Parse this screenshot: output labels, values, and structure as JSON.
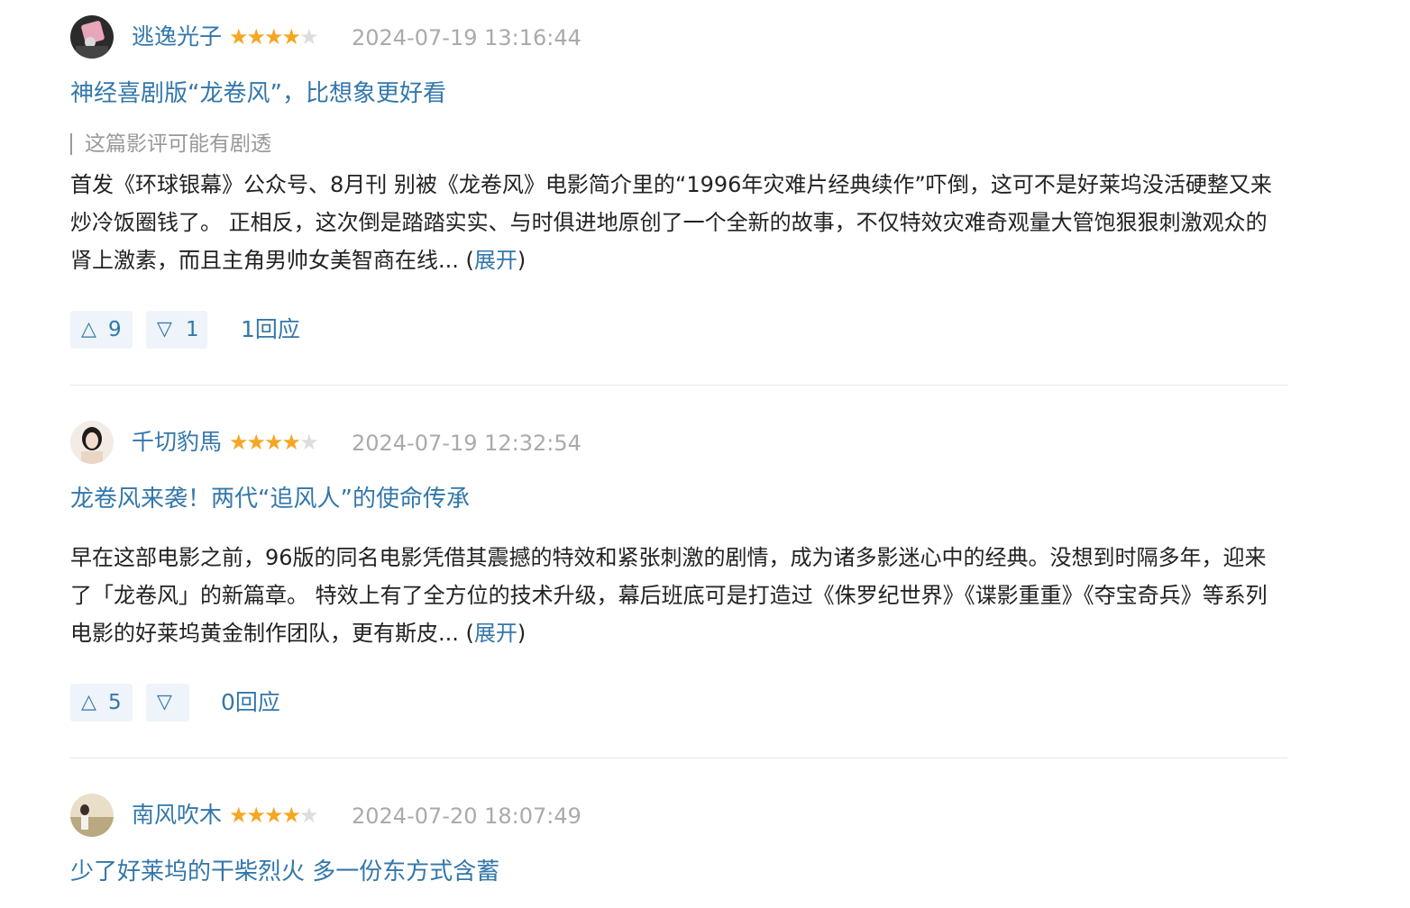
{
  "reviews": [
    {
      "author": "逃逸光子",
      "rating": 4,
      "rating_max": 5,
      "date": "2024-07-19 13:16:44",
      "title": "神经喜剧版“龙卷风”，比想象更好看",
      "spoiler": "这篇影评可能有剧透",
      "excerpt": "首发《环球银幕》公众号、8月刊 别被《龙卷风》电影简介里的“1996年灾难片经典续作”吓倒，这可不是好莱坞没活硬整又来炒冷饭圈钱了。 正相反，这次倒是踏踏实实、与时俱进地原创了一个全新的故事，不仅特效灾难奇观量大管饱狠狠刺激观众的肾上激素，而且主角男帅女美智商在线...",
      "expand_open": " (",
      "expand_label": "展开",
      "expand_close": ")",
      "useful_icon": "△",
      "useful_count": "9",
      "useless_icon": "▽",
      "useless_count": "1",
      "replies": "1回应"
    },
    {
      "author": "千切豹馬",
      "rating": 4,
      "rating_max": 5,
      "date": "2024-07-19 12:32:54",
      "title": "龙卷风来袭！两代“追风人”的使命传承",
      "excerpt": "早在这部电影之前，96版的同名电影凭借其震撼的特效和紧张刺激的剧情，成为诸多影迷心中的经典。没想到时隔多年，迎来了「龙卷风」的新篇章。 特效上有了全方位的技术升级，幕后班底可是打造过《侏罗纪世界》《谍影重重》《夺宝奇兵》等系列电影的好莱坞黄金制作团队，更有斯皮...",
      "expand_open": " (",
      "expand_label": "展开",
      "expand_close": ")",
      "useful_icon": "△",
      "useful_count": "5",
      "useless_icon": "▽",
      "useless_count": "",
      "replies": "0回应"
    },
    {
      "author": "南风吹木",
      "rating": 4,
      "rating_max": 5,
      "date": "2024-07-20 18:07:49",
      "title": "少了好莱坞的干柴烈火 多一份东方式含蓄"
    }
  ],
  "colors": {
    "link": "#3377aa",
    "star_on": "#f5a623",
    "star_off": "#dddddd",
    "muted": "#aaaaaa",
    "vote_bg": "#eef4f9"
  },
  "icons": {
    "star": "★",
    "useful": "triangle-up-outline-icon",
    "useless": "triangle-down-outline-icon"
  }
}
